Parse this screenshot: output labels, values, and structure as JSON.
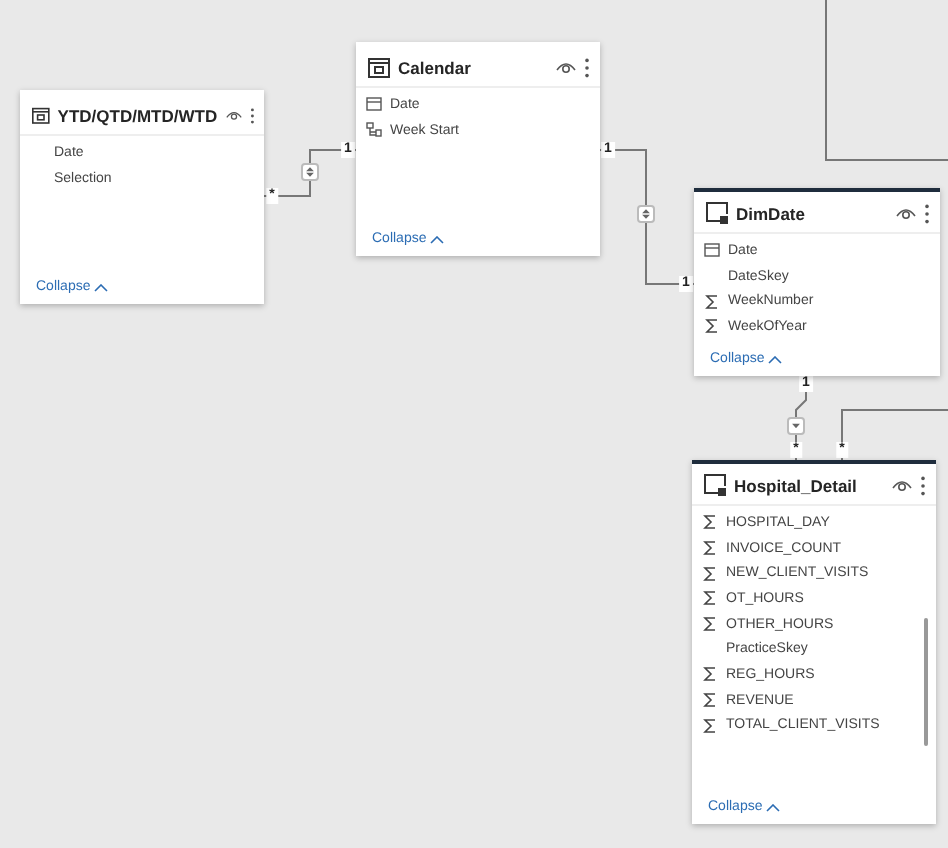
{
  "tables": [
    {
      "name": "YTD/QTD/MTD/WTD",
      "kind": "calendar",
      "highlighted": false,
      "scrollable": false,
      "fields": [
        {
          "name": "Date",
          "kind": "none"
        },
        {
          "name": "Selection",
          "kind": "none"
        }
      ],
      "collapse": "Collapse"
    },
    {
      "name": "Calendar",
      "kind": "calendar",
      "highlighted": false,
      "scrollable": false,
      "fields": [
        {
          "name": "Date",
          "kind": "date"
        },
        {
          "name": "Week Start",
          "kind": "hierarchy"
        }
      ],
      "collapse": "Collapse"
    },
    {
      "name": "DimDate",
      "kind": "table",
      "highlighted": true,
      "scrollable": false,
      "fields": [
        {
          "name": "Date",
          "kind": "date"
        },
        {
          "name": "DateSkey",
          "kind": "none"
        },
        {
          "name": "WeekNumber",
          "kind": "sum"
        },
        {
          "name": "WeekOfYear",
          "kind": "sum"
        }
      ],
      "collapse": "Collapse"
    },
    {
      "name": "Hospital_Detail",
      "kind": "table",
      "highlighted": true,
      "scrollable": true,
      "fields": [
        {
          "name": "HOSPITAL_DAY",
          "kind": "sum"
        },
        {
          "name": "INVOICE_COUNT",
          "kind": "sum"
        },
        {
          "name": "NEW_CLIENT_VISITS",
          "kind": "sum"
        },
        {
          "name": "OT_HOURS",
          "kind": "sum"
        },
        {
          "name": "OTHER_HOURS",
          "kind": "sum"
        },
        {
          "name": "PracticeSkey",
          "kind": "none"
        },
        {
          "name": "REG_HOURS",
          "kind": "sum"
        },
        {
          "name": "REVENUE",
          "kind": "sum"
        },
        {
          "name": "TOTAL_CLIENT_VISITS",
          "kind": "sum"
        }
      ],
      "collapse": "Collapse"
    }
  ],
  "relationships": [
    {
      "kind": "both",
      "ends": [
        "*",
        "1"
      ]
    },
    {
      "kind": "both",
      "ends": [
        "1",
        "1"
      ]
    },
    {
      "kind": "single",
      "ends": [
        "1",
        "*"
      ]
    },
    {
      "kind": "none",
      "ends": [
        "*"
      ]
    }
  ]
}
